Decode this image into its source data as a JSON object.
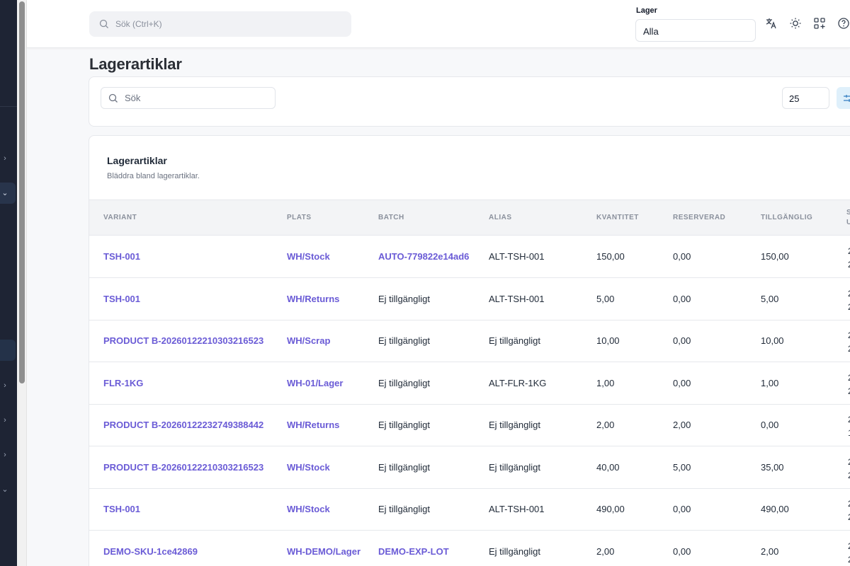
{
  "topbar": {
    "search_placeholder": "Sök (Ctrl+K)",
    "warehouse_label": "Lager",
    "warehouse_value": "Alla",
    "icons": [
      "translate-icon",
      "sun-icon",
      "apps-icon",
      "help-icon"
    ]
  },
  "page": {
    "title": "Lagerartiklar"
  },
  "filters": {
    "search_placeholder": "Sök",
    "per_page": "25"
  },
  "table": {
    "title": "Lagerartiklar",
    "subtitle": "Bläddra bland lagerartiklar.",
    "columns": [
      "VARIANT",
      "PLATS",
      "BATCH",
      "ALIAS",
      "KVANTITET",
      "RESERVERAD",
      "TILLGÄNGLIG"
    ],
    "cut_column_header": [
      "S",
      "U"
    ],
    "rows": [
      {
        "variant": "TSH-001",
        "plats": "WH/Stock",
        "batch": "AUTO-779822e14ad6",
        "batch_link": true,
        "alias": "ALT-TSH-001",
        "kvantitet": "150,00",
        "reserverad": "0,00",
        "tillganglig": "150,00",
        "cut": [
          "2",
          "2"
        ]
      },
      {
        "variant": "TSH-001",
        "plats": "WH/Returns",
        "batch": "Ej tillgängligt",
        "batch_link": false,
        "alias": "ALT-TSH-001",
        "kvantitet": "5,00",
        "reserverad": "0,00",
        "tillganglig": "5,00",
        "cut": [
          "2",
          "2"
        ]
      },
      {
        "variant": "PRODUCT B-20260122210303216523",
        "plats": "WH/Scrap",
        "batch": "Ej tillgängligt",
        "batch_link": false,
        "alias": "Ej tillgängligt",
        "kvantitet": "10,00",
        "reserverad": "0,00",
        "tillganglig": "10,00",
        "cut": [
          "2",
          "2"
        ]
      },
      {
        "variant": "FLR-1KG",
        "plats": "WH-01/Lager",
        "batch": "Ej tillgängligt",
        "batch_link": false,
        "alias": "ALT-FLR-1KG",
        "kvantitet": "1,00",
        "reserverad": "0,00",
        "tillganglig": "1,00",
        "cut": [
          "2",
          "2"
        ]
      },
      {
        "variant": "PRODUCT B-20260122232749388442",
        "plats": "WH/Returns",
        "batch": "Ej tillgängligt",
        "batch_link": false,
        "alias": "Ej tillgängligt",
        "kvantitet": "2,00",
        "reserverad": "2,00",
        "tillganglig": "0,00",
        "cut": [
          "2",
          "1"
        ]
      },
      {
        "variant": "PRODUCT B-20260122210303216523",
        "plats": "WH/Stock",
        "batch": "Ej tillgängligt",
        "batch_link": false,
        "alias": "Ej tillgängligt",
        "kvantitet": "40,00",
        "reserverad": "5,00",
        "tillganglig": "35,00",
        "cut": [
          "2",
          "2"
        ]
      },
      {
        "variant": "TSH-001",
        "plats": "WH/Stock",
        "batch": "Ej tillgängligt",
        "batch_link": false,
        "alias": "ALT-TSH-001",
        "kvantitet": "490,00",
        "reserverad": "0,00",
        "tillganglig": "490,00",
        "cut": [
          "2",
          "2"
        ]
      },
      {
        "variant": "DEMO-SKU-1ce42869",
        "plats": "WH-DEMO/Lager",
        "batch": "DEMO-EXP-LOT",
        "batch_link": true,
        "alias": "Ej tillgängligt",
        "kvantitet": "2,00",
        "reserverad": "0,00",
        "tillganglig": "2,00",
        "cut": [
          "2",
          "2"
        ]
      }
    ]
  },
  "colors": {
    "link": "#6a5bd6",
    "sidebar": "#1e2434",
    "filter_button": "#dff0fb"
  }
}
